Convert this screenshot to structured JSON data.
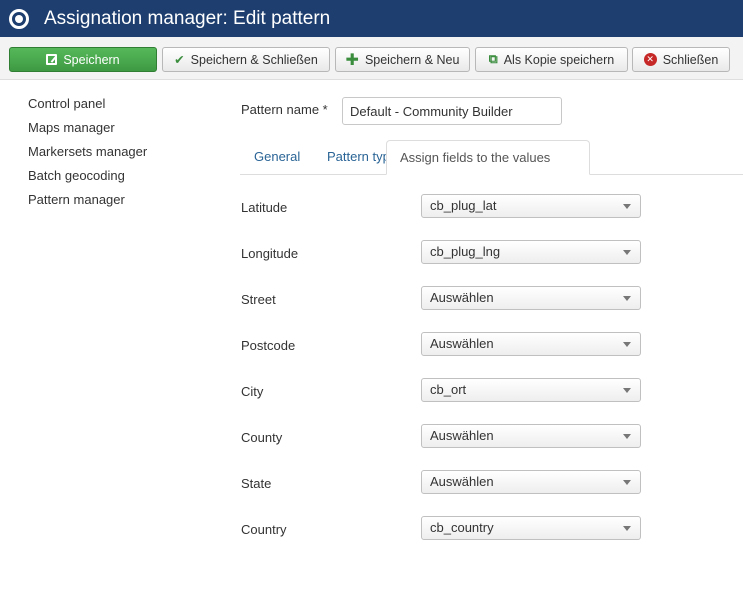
{
  "header": {
    "title": "Assignation manager: Edit pattern",
    "logo_icon": "joomla-logo-icon"
  },
  "toolbar": {
    "save": "Speichern",
    "save_close": "Speichern & Schließen",
    "save_new": "Speichern & Neu",
    "save_copy": "Als Kopie speichern",
    "close": "Schließen"
  },
  "sidebar": {
    "items": [
      {
        "label": "Control panel"
      },
      {
        "label": "Maps manager"
      },
      {
        "label": "Markersets manager"
      },
      {
        "label": "Batch geocoding"
      },
      {
        "label": "Pattern manager"
      }
    ]
  },
  "form": {
    "pattern_name_label": "Pattern name *",
    "pattern_name_value": "Default - Community Builder",
    "tabs": [
      {
        "label": "General"
      },
      {
        "label": "Pattern type"
      },
      {
        "label": "Assign fields to the values",
        "active": true
      }
    ],
    "fields": [
      {
        "label": "Latitude",
        "value": "cb_plug_lat"
      },
      {
        "label": "Longitude",
        "value": "cb_plug_lng"
      },
      {
        "label": "Street",
        "value": "Auswählen"
      },
      {
        "label": "Postcode",
        "value": "Auswählen"
      },
      {
        "label": "City",
        "value": "cb_ort"
      },
      {
        "label": "County",
        "value": "Auswählen"
      },
      {
        "label": "State",
        "value": "Auswählen"
      },
      {
        "label": "Country",
        "value": "cb_country"
      }
    ]
  },
  "colors": {
    "titlebar": "#1d3e6e",
    "save_button": "#4cae4f",
    "link": "#2a6496"
  }
}
